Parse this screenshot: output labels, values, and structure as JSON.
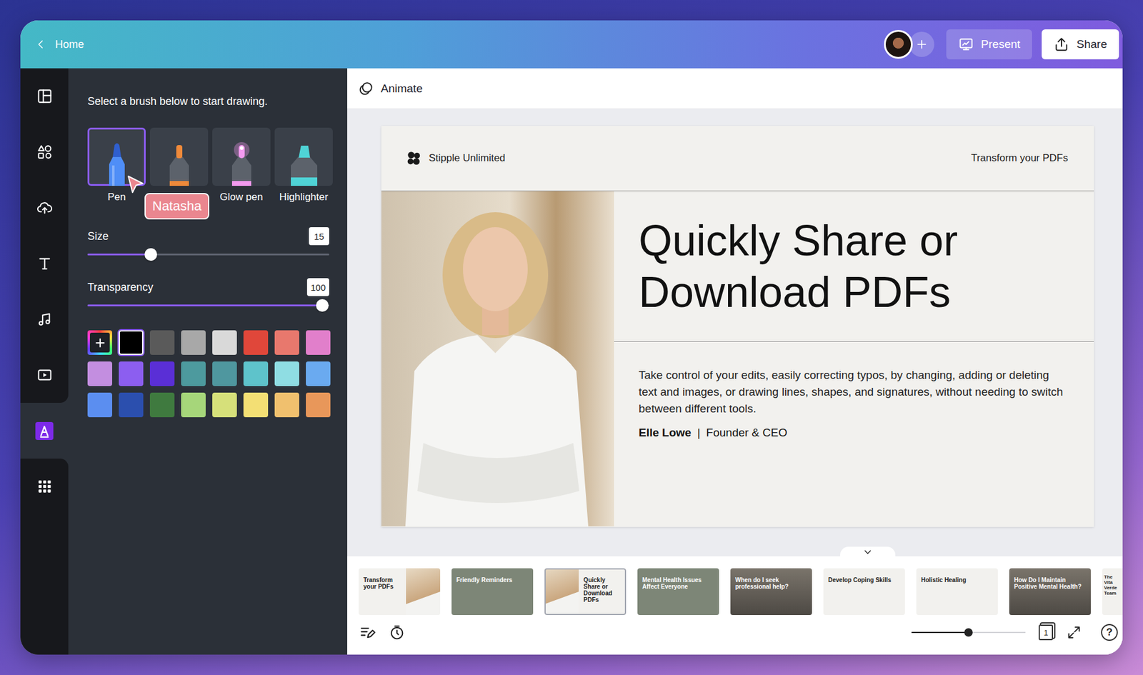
{
  "topbar": {
    "back": {
      "label": "Home"
    },
    "present": {
      "label": "Present"
    },
    "share": {
      "label": "Share"
    }
  },
  "sidebar": {
    "items": [
      {
        "kind": "layout",
        "selected": false
      },
      {
        "kind": "elements",
        "selected": false
      },
      {
        "kind": "uploads",
        "selected": false
      },
      {
        "kind": "text",
        "selected": false
      },
      {
        "kind": "audio",
        "selected": false
      },
      {
        "kind": "video",
        "selected": false
      },
      {
        "kind": "draw",
        "selected": true
      },
      {
        "kind": "apps",
        "selected": false
      }
    ]
  },
  "draw_panel": {
    "hint": "Select a brush below to start drawing.",
    "brushes": [
      {
        "kind": "pen",
        "label": "Pen",
        "selected": true,
        "color": "#4f8ef7"
      },
      {
        "kind": "marker",
        "selected": false,
        "color": "#f08a3a"
      },
      {
        "kind": "glow",
        "label": "Glow pen",
        "selected": false,
        "color": "#f49af0"
      },
      {
        "kind": "highlighter",
        "label": "Highlighter",
        "selected": false,
        "color": "#4fd3d6"
      }
    ],
    "sliders": [
      {
        "label": "Size",
        "value": "15",
        "level": 0.26
      },
      {
        "label": "Transparency",
        "value": "100",
        "level": 0.97
      }
    ],
    "colors": [
      {
        "kind": "add",
        "selected": false
      },
      {
        "kind": "swatch",
        "color": "#000000",
        "selected": true
      },
      {
        "kind": "swatch",
        "color": "#5a5a5a",
        "selected": false
      },
      {
        "kind": "swatch",
        "color": "#a8a8a8",
        "selected": false
      },
      {
        "kind": "swatch",
        "color": "#d9d9d9",
        "selected": false
      },
      {
        "kind": "swatch",
        "color": "#e0473a",
        "selected": false
      },
      {
        "kind": "swatch",
        "color": "#e8786d",
        "selected": false
      },
      {
        "kind": "swatch",
        "color": "#e17fcb",
        "selected": false
      },
      {
        "kind": "swatch",
        "color": "#c38ee0",
        "selected": false
      },
      {
        "kind": "swatch",
        "color": "#8c5ef0",
        "selected": false
      },
      {
        "kind": "swatch",
        "color": "#5a2fd6",
        "selected": false
      },
      {
        "kind": "swatch",
        "color": "#4d9a9e",
        "selected": false
      },
      {
        "kind": "swatch",
        "color": "#4f979f",
        "selected": false
      },
      {
        "kind": "swatch",
        "color": "#5ec3cb",
        "selected": false
      },
      {
        "kind": "swatch",
        "color": "#8fdde3",
        "selected": false
      },
      {
        "kind": "swatch",
        "color": "#6aaaf0",
        "selected": false
      },
      {
        "kind": "swatch",
        "color": "#5b8ef0",
        "selected": false
      },
      {
        "kind": "swatch",
        "color": "#2b4fae",
        "selected": false
      },
      {
        "kind": "swatch",
        "color": "#3f7a3f",
        "selected": false
      },
      {
        "kind": "swatch",
        "color": "#a6d67a",
        "selected": false
      },
      {
        "kind": "swatch",
        "color": "#d6e07a",
        "selected": false
      },
      {
        "kind": "swatch",
        "color": "#f3df74",
        "selected": false
      },
      {
        "kind": "swatch",
        "color": "#f0c06e",
        "selected": false
      },
      {
        "kind": "swatch",
        "color": "#e8975a",
        "selected": false
      }
    ]
  },
  "cursor": {
    "label": "Natasha"
  },
  "toolbar": {
    "animate": {
      "label": "Animate"
    }
  },
  "slide": {
    "brand": "Stipple Unlimited",
    "tagline": "Transform your PDFs",
    "title": "Quickly Share or Download PDFs",
    "body": "Take control of your edits, easily correcting typos, by changing, adding or deleting text and images, or drawing lines, shapes, and signatures, without needing to switch between different tools.",
    "author": {
      "name": "Elle Lowe",
      "separator": "|",
      "role": "Founder & CEO"
    }
  },
  "thumbnails": [
    {
      "title": "Transform your PDFs",
      "kind": "cover",
      "selected": false
    },
    {
      "title": "Friendly Reminders",
      "kind": "dark",
      "selected": false
    },
    {
      "title": "Quickly Share or Download PDFs",
      "kind": "split",
      "selected": true
    },
    {
      "title": "Mental Health Issues Affect Everyone",
      "kind": "dark",
      "selected": false
    },
    {
      "title": "When do I seek professional help?",
      "kind": "photo",
      "selected": false
    },
    {
      "title": "Develop Coping Skills",
      "kind": "light",
      "selected": false
    },
    {
      "title": "Holistic Healing",
      "kind": "light",
      "selected": false
    },
    {
      "title": "How Do I Maintain Positive Mental Health?",
      "kind": "photo",
      "selected": false
    },
    {
      "title": "The Vita Verde Team",
      "kind": "light",
      "selected": false
    }
  ],
  "bottom_bar": {
    "zoom": {
      "level": 0.5
    },
    "page": "1",
    "help": "?"
  }
}
